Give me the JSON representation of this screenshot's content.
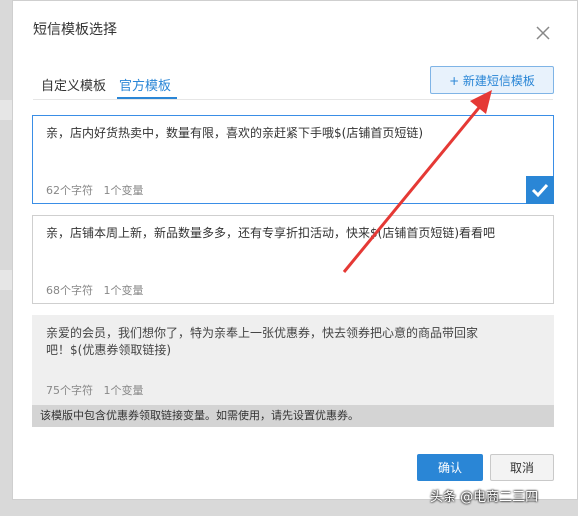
{
  "dialog": {
    "title": "短信模板选择",
    "tabs": [
      {
        "label": "自定义模板",
        "active": false
      },
      {
        "label": "官方模板",
        "active": true
      }
    ],
    "new_template_label": "+ 新建短信模板"
  },
  "templates": [
    {
      "text": "亲，店内好货热卖中，数量有限，喜欢的亲赶紧下手哦$(店铺首页短链)",
      "char_count": "62个字符",
      "var_count": "1个变量",
      "selected": true
    },
    {
      "text": "亲，店铺本周上新，新品数量多多，还有专享折扣活动，快来$(店铺首页短链)看看吧",
      "char_count": "68个字符",
      "var_count": "1个变量",
      "selected": false
    },
    {
      "text": "亲爱的会员，我们想你了，特为亲奉上一张优惠券，快去领券把心意的商品带回家吧！$(优惠券领取链接)",
      "char_count": "75个字符",
      "var_count": "1个变量",
      "disabled": true,
      "notice": "该模版中包含优惠券领取链接变量。如需使用，请先设置优惠券。"
    }
  ],
  "footer": {
    "confirm_label": "确认",
    "cancel_label": "取消"
  },
  "watermark": "头条 @电商二三四",
  "colors": {
    "accent": "#2a86d6",
    "arrow": "#e53935"
  },
  "icons": [
    "close-icon",
    "checkmark-icon",
    "annotation-arrow"
  ]
}
